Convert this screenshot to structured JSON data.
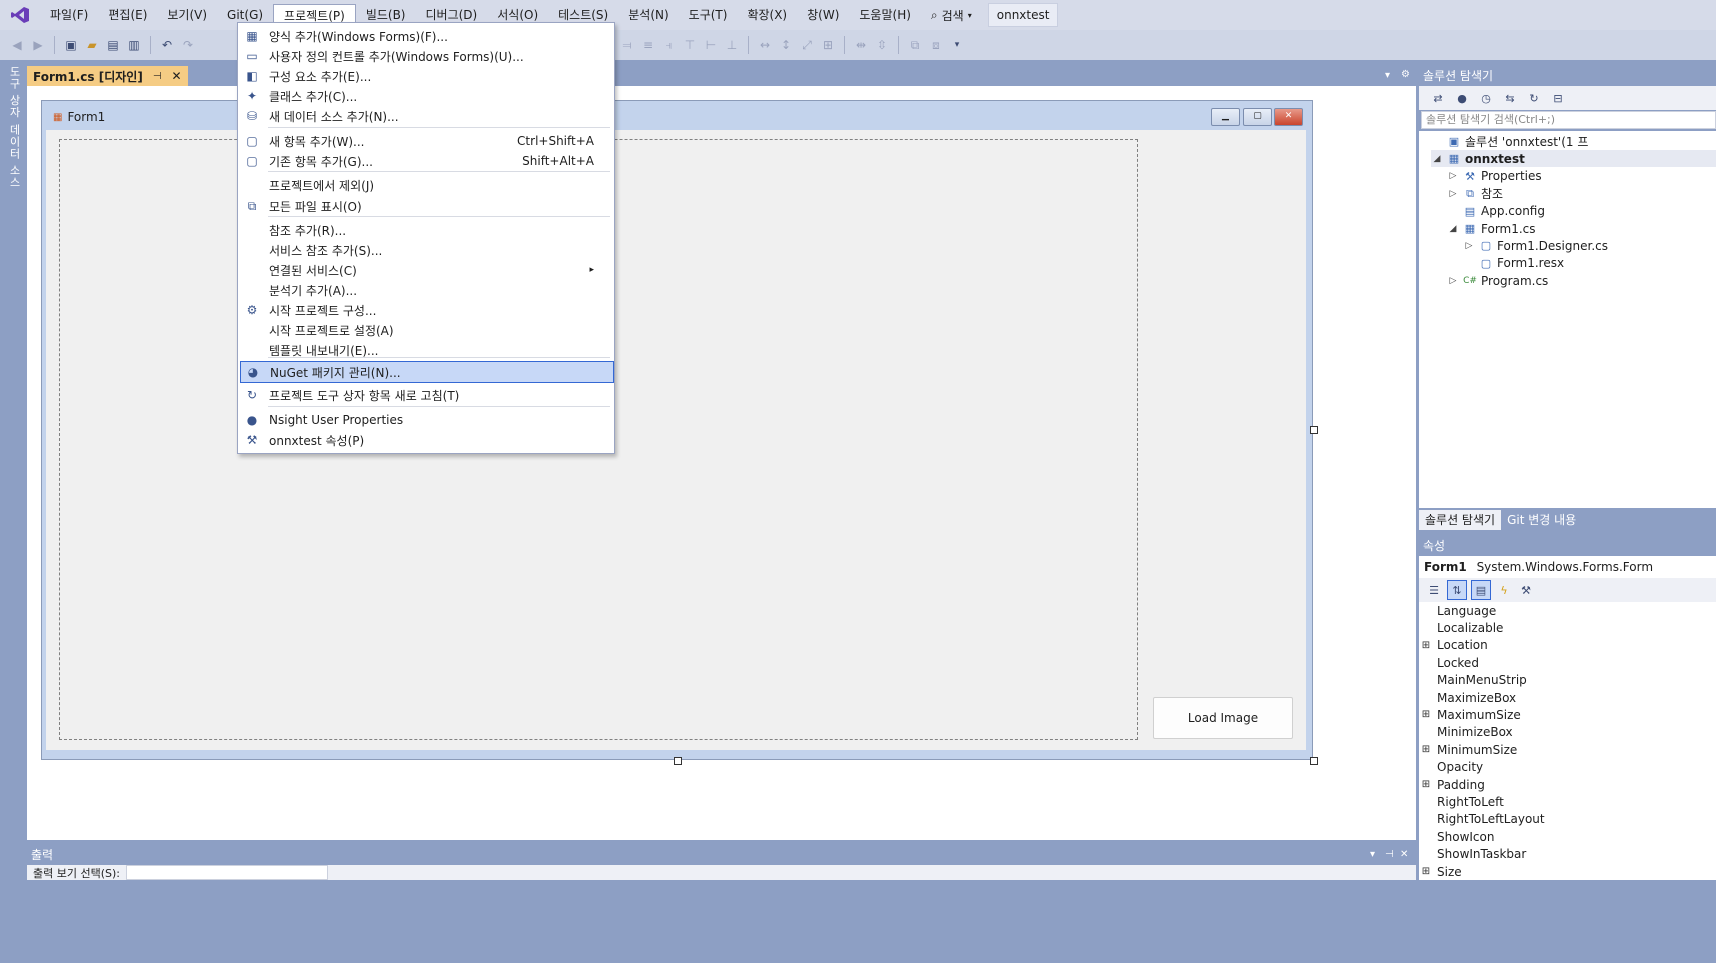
{
  "menubar": {
    "items": [
      "파일(F)",
      "편집(E)",
      "보기(V)",
      "Git(G)",
      "프로젝트(P)",
      "빌드(B)",
      "디버그(D)",
      "서식(O)",
      "테스트(S)",
      "분석(N)",
      "도구(T)",
      "확장(X)",
      "창(W)",
      "도움말(H)"
    ],
    "search_label": "검색",
    "solution_name": "onnxtest"
  },
  "left_strip": {
    "tabs": [
      "도구 상자",
      "데이터 소스"
    ]
  },
  "document_tab": {
    "label": "Form1.cs [디자인]"
  },
  "form": {
    "title": "Form1",
    "load_button": "Load Image"
  },
  "project_menu": {
    "items": [
      {
        "label": "양식 추가(Windows Forms)(F)...",
        "shortcut": "",
        "icon": "form-icon"
      },
      {
        "label": "사용자 정의 컨트롤 추가(Windows Forms)(U)...",
        "shortcut": "",
        "icon": "usercontrol-icon"
      },
      {
        "label": "구성 요소 추가(E)...",
        "shortcut": "",
        "icon": "component-icon"
      },
      {
        "label": "클래스 추가(C)...",
        "shortcut": "",
        "icon": "class-icon"
      },
      {
        "label": "새 데이터 소스 추가(N)...",
        "shortcut": "",
        "icon": "datasource-icon"
      },
      {
        "label": "새 항목 추가(W)...",
        "shortcut": "Ctrl+Shift+A",
        "icon": "newitem-icon"
      },
      {
        "label": "기존 항목 추가(G)...",
        "shortcut": "Shift+Alt+A",
        "icon": "existingitem-icon"
      },
      {
        "label": "프로젝트에서 제외(J)",
        "shortcut": "",
        "icon": ""
      },
      {
        "label": "모든 파일 표시(O)",
        "shortcut": "",
        "icon": "showallfiles-icon"
      },
      {
        "label": "참조 추가(R)...",
        "shortcut": "",
        "icon": ""
      },
      {
        "label": "서비스 참조 추가(S)...",
        "shortcut": "",
        "icon": ""
      },
      {
        "label": "연결된 서비스(C)",
        "shortcut": "",
        "icon": "",
        "submenu": true
      },
      {
        "label": "분석기 추가(A)...",
        "shortcut": "",
        "icon": ""
      },
      {
        "label": "시작 프로젝트 구성...",
        "shortcut": "",
        "icon": "gear-icon"
      },
      {
        "label": "시작 프로젝트로 설정(A)",
        "shortcut": "",
        "icon": ""
      },
      {
        "label": "템플릿 내보내기(E)...",
        "shortcut": "",
        "icon": ""
      },
      {
        "label": "NuGet 패키지 관리(N)...",
        "shortcut": "",
        "icon": "nuget-icon",
        "highlighted": true
      },
      {
        "label": "프로젝트 도구 상자 항목 새로 고침(T)",
        "shortcut": "",
        "icon": "refresh-icon"
      },
      {
        "label": "Nsight User Properties",
        "shortcut": "",
        "icon": "nsight-icon"
      },
      {
        "label": "onnxtest 속성(P)",
        "shortcut": "",
        "icon": "wrench-icon"
      }
    ]
  },
  "solution_explorer": {
    "title": "솔루션 탐색기",
    "search_placeholder": "솔루션 탐색기 검색(Ctrl+;)",
    "tree": [
      {
        "label": "솔루션 'onnxtest'(1 프",
        "expander": "",
        "icon": "solution-icon"
      },
      {
        "label": "onnxtest",
        "expander": "◢",
        "icon": "project-icon"
      },
      {
        "label": "Properties",
        "expander": "▷",
        "icon": "wrench-icon"
      },
      {
        "label": "참조",
        "expander": "▷",
        "icon": "references-icon"
      },
      {
        "label": "App.config",
        "expander": "",
        "icon": "config-icon"
      },
      {
        "label": "Form1.cs",
        "expander": "◢",
        "icon": "form-icon"
      },
      {
        "label": "Form1.Designer.cs",
        "expander": "▷",
        "icon": "file-icon"
      },
      {
        "label": "Form1.resx",
        "expander": "",
        "icon": "file-icon"
      },
      {
        "label": "Program.cs",
        "expander": "▷",
        "icon": "csharp-icon"
      }
    ],
    "tabs": [
      "솔루션 탐색기",
      "Git 변경 내용"
    ]
  },
  "properties": {
    "title": "속성",
    "object_name": "Form1",
    "object_type": "System.Windows.Forms.Form",
    "rows": [
      {
        "name": "Language",
        "expandable": false
      },
      {
        "name": "Localizable",
        "expandable": false
      },
      {
        "name": "Location",
        "expandable": true
      },
      {
        "name": "Locked",
        "expandable": false
      },
      {
        "name": "MainMenuStrip",
        "expandable": false
      },
      {
        "name": "MaximizeBox",
        "expandable": false
      },
      {
        "name": "MaximumSize",
        "expandable": true
      },
      {
        "name": "MinimizeBox",
        "expandable": false
      },
      {
        "name": "MinimumSize",
        "expandable": true
      },
      {
        "name": "Opacity",
        "expandable": false
      },
      {
        "name": "Padding",
        "expandable": true
      },
      {
        "name": "RightToLeft",
        "expandable": false
      },
      {
        "name": "RightToLeftLayout",
        "expandable": false
      },
      {
        "name": "ShowIcon",
        "expandable": false
      },
      {
        "name": "ShowInTaskbar",
        "expandable": false
      },
      {
        "name": "Size",
        "expandable": true
      }
    ]
  },
  "output": {
    "title": "출력",
    "source_label": "출력 보기 선택(S):"
  }
}
